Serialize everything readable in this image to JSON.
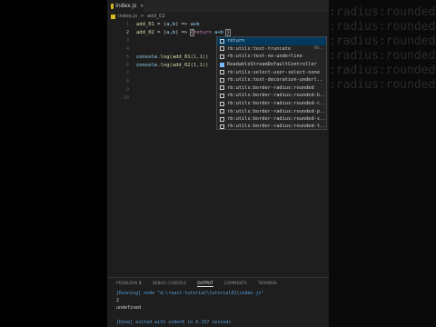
{
  "tab": {
    "label": "index.js",
    "close": "×"
  },
  "breadcrumb": {
    "file": "index.js",
    "separator": ">",
    "symbol": "add_02"
  },
  "code": {
    "line1": {
      "num": "1",
      "name": "add_01",
      "rest1": " = (",
      "p1": "a",
      "comma": ",",
      "p2": "b",
      "rest2": ") => ",
      "body": "a+b"
    },
    "line2": {
      "num": "2",
      "name": "add_02",
      "rest1": " = (",
      "p1": "a",
      "comma": ",",
      "p2": "b",
      "rest2": ") => ",
      "brace_open": "{",
      "kw": "return",
      "body": " a+b ",
      "brace_close": "}"
    },
    "line3": {
      "num": "3"
    },
    "line4": {
      "num": "4"
    },
    "line5": {
      "num": "5",
      "obj": "console",
      "method": ".log(",
      "fn": "add_01",
      "args": "(1,1))"
    },
    "line6": {
      "num": "6",
      "obj": "console",
      "method": ".log(",
      "fn": "add_02",
      "args": "(1,1))"
    },
    "line7": {
      "num": "7"
    },
    "line8": {
      "num": "8"
    },
    "line9": {
      "num": "9"
    },
    "line10": {
      "num": "10"
    }
  },
  "suggest": {
    "items": [
      {
        "label": "return",
        "detail": "",
        "icon": "keyword-icon"
      },
      {
        "label": "rb:utils:text-truncate",
        "detail": "Rb..",
        "icon": "snippet-icon"
      },
      {
        "label": "rb:utils:text-no-underline",
        "detail": "",
        "icon": "snippet-icon"
      },
      {
        "label": "ReadableStreamDefaultController",
        "detail": "",
        "icon": "enum-icon"
      },
      {
        "label": "rb:utils:select-user-select-none",
        "detail": "",
        "icon": "snippet-icon"
      },
      {
        "label": "rb:utils:text-decoration-underl..",
        "detail": "",
        "icon": "snippet-icon"
      },
      {
        "label": "rb:utils:border-radius:rounded",
        "detail": "",
        "icon": "snippet-icon"
      },
      {
        "label": "rb:utils:border-radius:rounded-b..",
        "detail": "",
        "icon": "snippet-icon"
      },
      {
        "label": "rb:utils:border-radius:rounded-c..",
        "detail": "",
        "icon": "snippet-icon"
      },
      {
        "label": "rb:utils:border-radius:rounded-p..",
        "detail": "",
        "icon": "snippet-icon"
      },
      {
        "label": "rb:utils:border-radius:rounded-s..",
        "detail": "",
        "icon": "snippet-icon"
      },
      {
        "label": "rb:utils:border-radius:rounded-t..",
        "detail": "",
        "icon": "snippet-icon"
      }
    ]
  },
  "panel": {
    "tabs": [
      "PROBLEMS",
      "1",
      "DEBUG CONSOLE",
      "OUTPUT",
      "COMMENTS",
      "TERMINAL"
    ],
    "output": {
      "running": "[Running] node \"d:\\react-tutorial\\tutorial02\\index.js\"",
      "value": "2",
      "undefined": "undefined",
      "done": "[Done] exited with code=0 in 0.157 seconds"
    }
  },
  "ghost": {
    "lines": [
      ":radius:rounded",
      ":radius:rounded-bo",
      ":radius:rounded-ci",
      ":radius:rounded-pi",
      ":radius:rounded-sh",
      ":radius:rounded-to"
    ]
  }
}
